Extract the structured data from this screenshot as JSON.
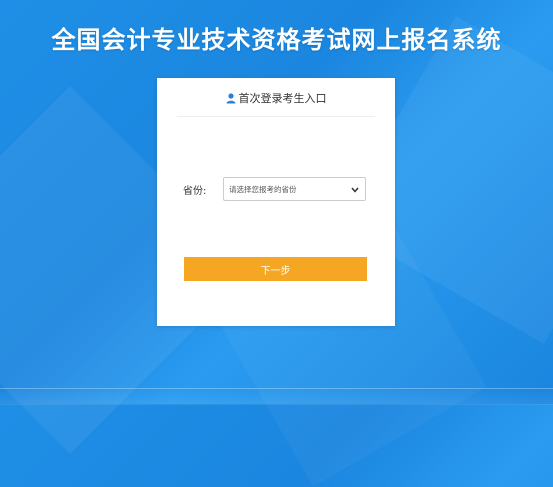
{
  "page": {
    "title": "全国会计专业技术资格考试网上报名系统"
  },
  "login": {
    "header": "首次登录考生入口",
    "province_label": "省份:",
    "province_select_value": "请选择您报考的省份",
    "next_button": "下一步"
  },
  "colors": {
    "background": "#1f8fe6",
    "button": "#f5a623",
    "card": "#ffffff"
  },
  "icons": [
    "user-icon",
    "chevron-down-icon"
  ]
}
